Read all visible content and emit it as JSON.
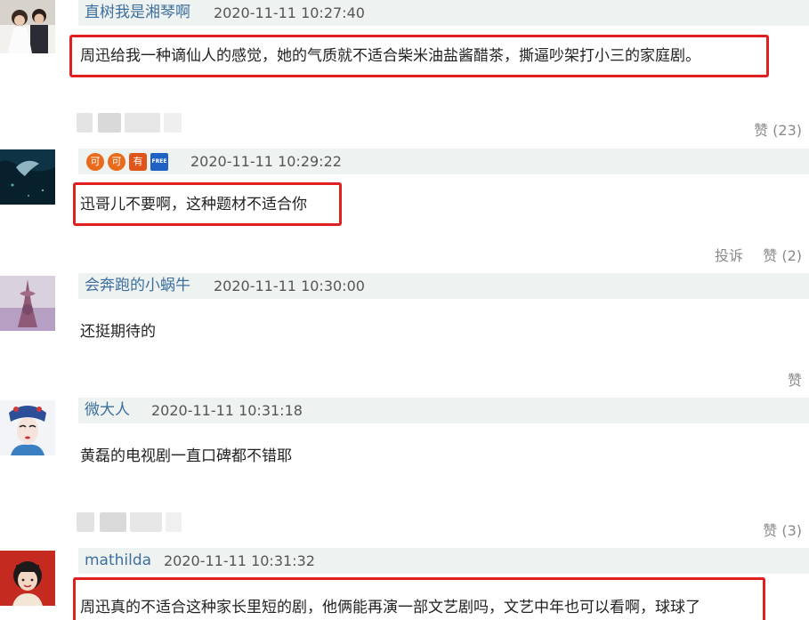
{
  "comments": [
    {
      "username": "直树我是湘琴啊",
      "time": "2020-11-11 10:27:40",
      "text": "周迅给我一种谪仙人的感觉，她的气质就不适合柴米油盐酱醋茶，撕逼吵架打小三的家庭剧。",
      "highlighted": true
    },
    {
      "badges": [
        "可",
        "可",
        "有",
        "FREE"
      ],
      "time": "2020-11-11 10:29:22",
      "text": "迅哥儿不要啊，这种题材不适合你",
      "highlighted": true
    },
    {
      "username": "会奔跑的小蜗牛",
      "time": "2020-11-11 10:30:00",
      "text": "还挺期待的",
      "highlighted": false
    },
    {
      "username": "微大人",
      "time": "2020-11-11 10:31:18",
      "text": "黄磊的电视剧一直口碑都不错耶",
      "highlighted": false
    },
    {
      "username": "mathilda",
      "time": "2020-11-11 10:31:32",
      "text": "周迅真的不适合这种家长里短的剧，他俩能再演一部文艺剧吗，文艺中年也可以看啊，球球了",
      "highlighted": true
    }
  ],
  "actions": {
    "like_1": "赞 (23)",
    "report": "投诉",
    "like_2": "赞 (2)",
    "like_3": "赞",
    "like_4": "赞 (3)"
  },
  "colors": {
    "highlight_border": "#e02020",
    "username": "#3d6f9e",
    "meta_bar_bg": "#eef3f1"
  }
}
